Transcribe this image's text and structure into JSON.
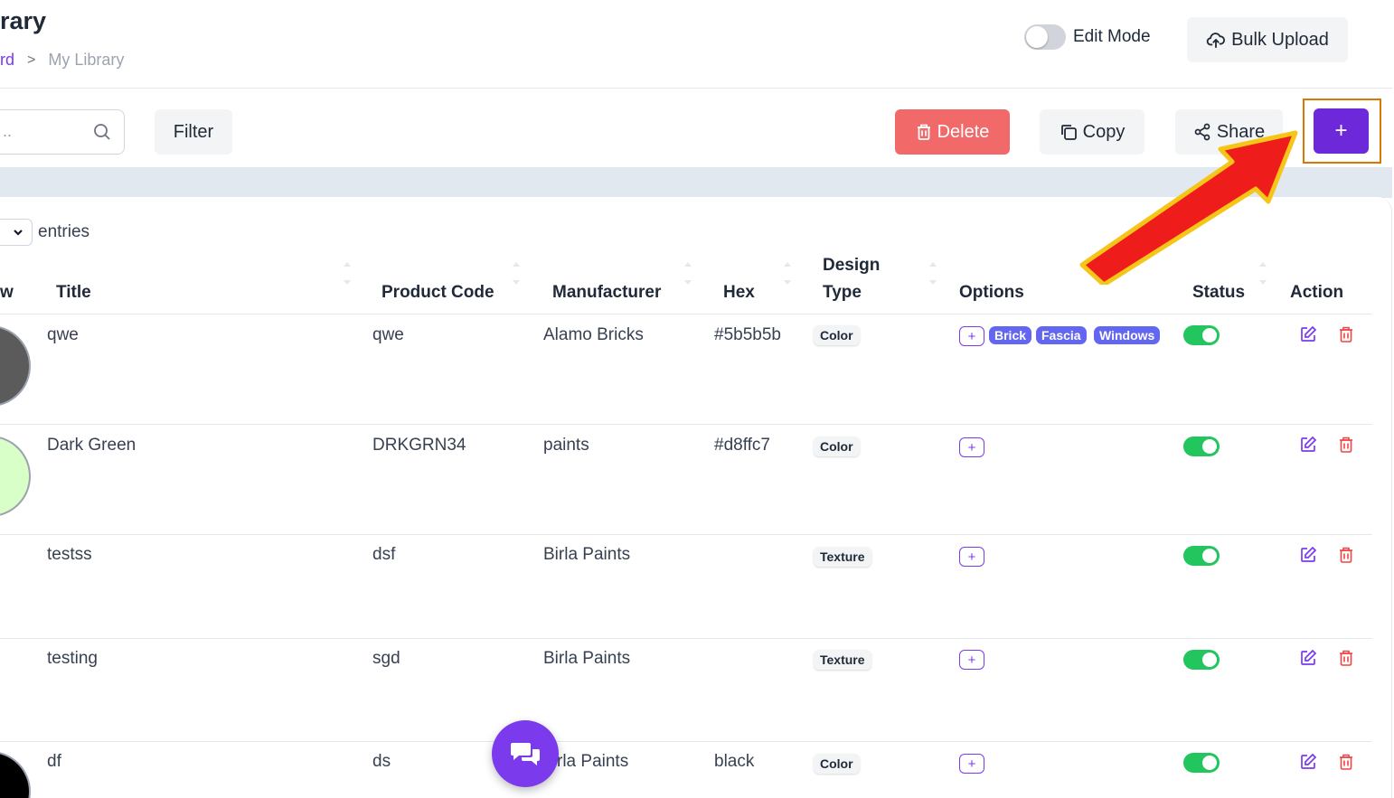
{
  "header": {
    "title": "rary",
    "breadcrumb": {
      "first": "rd",
      "separator": ">",
      "current": "My Library"
    },
    "edit_mode_label": "Edit Mode",
    "bulk_upload_label": "Bulk Upload"
  },
  "toolbar": {
    "search_placeholder": "..",
    "filter_label": "Filter",
    "delete_label": "Delete",
    "copy_label": "Copy",
    "share_label": "Share",
    "add_label": "+"
  },
  "entries_label": "entries",
  "table": {
    "columns": {
      "preview": "w",
      "title": "Title",
      "product_code": "Product Code",
      "manufacturer": "Manufacturer",
      "hex": "Hex",
      "design_type_1": "Design",
      "design_type_2": "Type",
      "options": "Options",
      "status": "Status",
      "action": "Action"
    },
    "rows": [
      {
        "title": "qwe",
        "code": "qwe",
        "manufacturer": "Alamo Bricks",
        "hex": "#5b5b5b",
        "type": "Color",
        "swatch": "#5b5b5b",
        "options": [
          "Brick",
          "Fascia",
          "Windows"
        ]
      },
      {
        "title": "Dark Green",
        "code": "DRKGRN34",
        "manufacturer": "paints",
        "hex": "#d8ffc7",
        "type": "Color",
        "swatch": "#d8ffc7",
        "options": []
      },
      {
        "title": "testss",
        "code": "dsf",
        "manufacturer": "Birla Paints",
        "hex": "",
        "type": "Texture",
        "swatch": "",
        "options": []
      },
      {
        "title": "testing",
        "code": "sgd",
        "manufacturer": "Birla Paints",
        "hex": "",
        "type": "Texture",
        "swatch": "",
        "options": []
      },
      {
        "title": "df",
        "code": "ds",
        "manufacturer": "rla Paints",
        "hex": "black",
        "type": "Color",
        "swatch": "#000000",
        "options": []
      }
    ]
  },
  "colors": {
    "accent": "#6d28d9",
    "danger": "#f16969",
    "status_on": "#22c55e",
    "chip": "#6366f1"
  },
  "icons": {
    "search": "search-icon",
    "upload": "cloud-upload-icon",
    "trash": "trash-icon",
    "copy": "copy-icon",
    "share": "share-icon",
    "edit": "edit-icon",
    "chat": "chat-icon"
  }
}
